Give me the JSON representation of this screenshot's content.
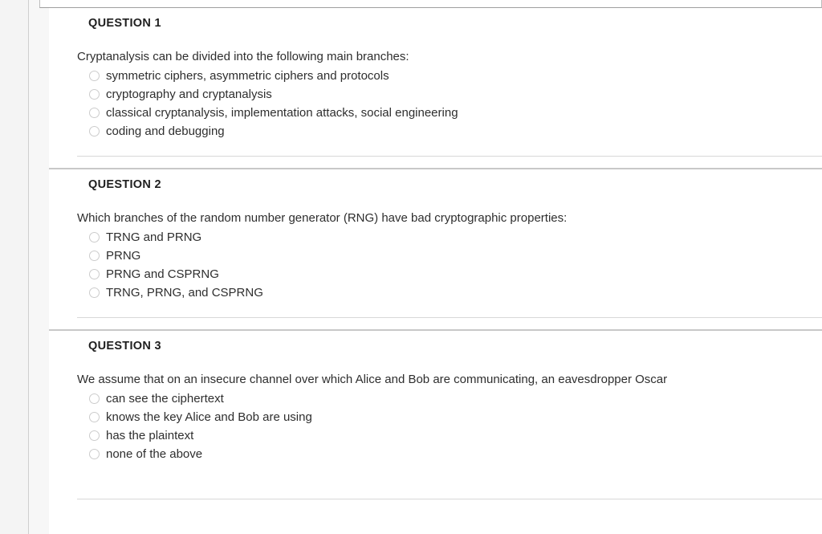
{
  "questions": [
    {
      "title": "QUESTION 1",
      "prompt": "Cryptanalysis can be divided into the following main branches:",
      "options": [
        "symmetric ciphers, asymmetric ciphers and protocols",
        "cryptography and cryptanalysis",
        "classical cryptanalysis, implementation attacks, social engineering",
        "coding and debugging"
      ]
    },
    {
      "title": "QUESTION 2",
      "prompt": "Which branches of the random number generator (RNG) have bad cryptographic properties:",
      "options": [
        "TRNG and PRNG",
        "PRNG",
        "PRNG and CSPRNG",
        "TRNG, PRNG, and CSPRNG"
      ]
    },
    {
      "title": "QUESTION 3",
      "prompt": "We assume that on an insecure channel over which Alice and Bob are communicating, an eavesdropper Oscar",
      "options": [
        "can see the ciphertext",
        "knows the key Alice and Bob are using",
        "has the plaintext",
        "none of the above"
      ]
    }
  ],
  "colors": {
    "page_background": "#ffffff",
    "gutter": "#f4f4f4",
    "divider": "#c8c8c8",
    "inner_rule": "#d8d8d8",
    "heading_text": "#1f1f1f",
    "body_text": "#2e2e2e",
    "radio_border": "#cccccc"
  }
}
